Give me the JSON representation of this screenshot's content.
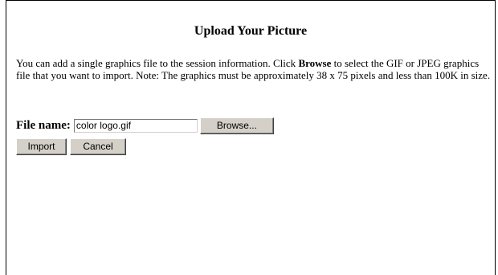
{
  "dialog": {
    "title": "Upload Your Picture",
    "desc_pre": "You can add a single graphics file to the session information. Click ",
    "desc_bold": "Browse",
    "desc_post": " to select the GIF or JPEG graphics file that you want to import. Note: The graphics must be approximately 38 x 75 pixels and less than 100K in size."
  },
  "file": {
    "label": "File name:",
    "value": "color logo.gif",
    "browse_label": "Browse..."
  },
  "actions": {
    "import_label": "Import",
    "cancel_label": "Cancel"
  }
}
